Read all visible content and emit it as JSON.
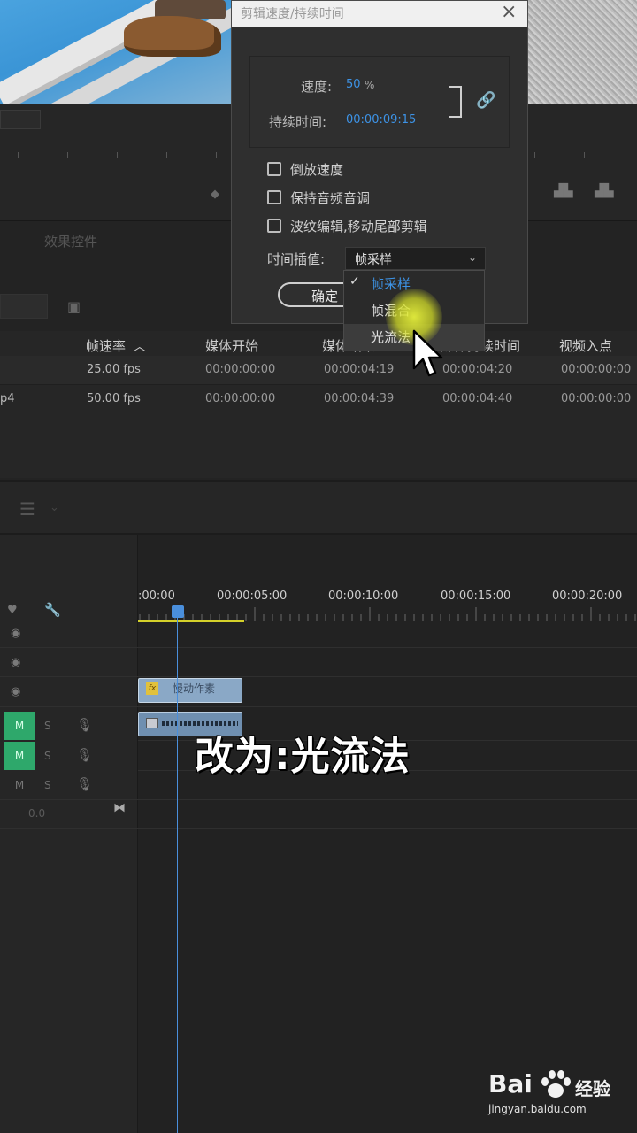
{
  "dialog": {
    "title": "剪辑速度/持续时间",
    "speed_label": "速度:",
    "speed_value": "50",
    "speed_unit": "%",
    "duration_label": "持续时间:",
    "duration_value": "00:00:09:15",
    "checkboxes": [
      {
        "label": "倒放速度",
        "checked": false
      },
      {
        "label": "保持音频音调",
        "checked": false
      },
      {
        "label": "波纹编辑,移动尾部剪辑",
        "checked": false
      }
    ],
    "interpolation_label": "时间插值:",
    "interpolation_value": "帧采样",
    "ok_label": "确定"
  },
  "dropdown": {
    "options": [
      "帧采样",
      "帧混合",
      "光流法"
    ],
    "selected": "帧采样"
  },
  "panels": {
    "effects_tab": "效果控件"
  },
  "project_table": {
    "headers": [
      "帧速率",
      "媒体开始",
      "媒体结束",
      "媒体持续时间",
      "视频入点"
    ],
    "rows": [
      {
        "name": "",
        "fps": "25.00 fps",
        "start": "00:00:00:00",
        "end": "00:00:04:19",
        "duration": "00:00:04:20",
        "in": "00:00:00:00"
      },
      {
        "name": "p4",
        "fps": "50.00 fps",
        "start": "00:00:00:00",
        "end": "00:00:04:39",
        "duration": "00:00:04:40",
        "in": "00:00:00:00"
      }
    ]
  },
  "timeline": {
    "timecodes": [
      ":00:00",
      "00:00:05:00",
      "00:00:10:00",
      "00:00:15:00",
      "00:00:20:00"
    ],
    "clip_label": "慢动作素",
    "mute_labels": [
      "M",
      "M",
      "M"
    ],
    "solo_labels": [
      "S",
      "S",
      "S"
    ],
    "volume_value": "0.0"
  },
  "caption": "改为:光流法",
  "watermark": {
    "brand": "Bai",
    "product": "经验",
    "url": "jingyan.baidu.com"
  },
  "colors": {
    "accent_blue": "#3d93e6",
    "mute_green": "#2ea86b",
    "highlight_yellow": "#e6f03c",
    "work_area": "#d4d02a"
  }
}
